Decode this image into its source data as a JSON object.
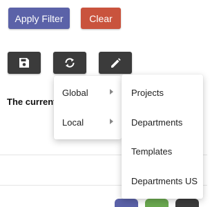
{
  "toolbar": {
    "apply_filter_label": "Apply Filter",
    "clear_label": "Clear",
    "icons": [
      "floppy-disk-icon",
      "sync-icon",
      "pencil-icon"
    ]
  },
  "content": {
    "current_text": "The current"
  },
  "context_menu": {
    "items": [
      {
        "label": "Global",
        "has_submenu": true
      },
      {
        "label": "Local",
        "has_submenu": true
      }
    ]
  },
  "submenu": {
    "items": [
      {
        "label": "Projects"
      },
      {
        "label": "Departments"
      },
      {
        "label": "Templates"
      },
      {
        "label": "Departments US"
      }
    ]
  },
  "colors": {
    "apply_button": "#5b62a8",
    "clear_button": "#c9533d",
    "tool_button": "#3b3b3b",
    "green_accent": "#6aa84f"
  }
}
